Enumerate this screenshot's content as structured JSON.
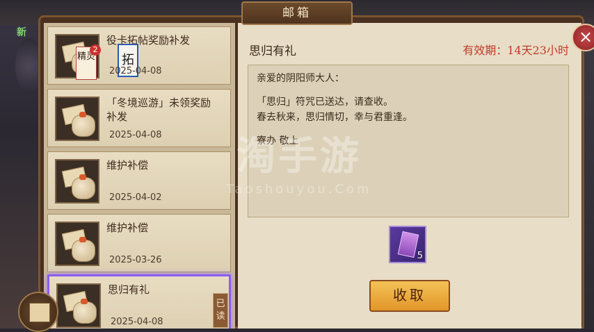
{
  "window": {
    "title": "邮箱"
  },
  "side": {
    "new_label": "新"
  },
  "mails": [
    {
      "title": "役卡拓帖奖励补发",
      "date": "2025-04-08",
      "badge": "2",
      "card_a": "精灵",
      "card_b": "拓"
    },
    {
      "title": "「冬境巡游」未领奖励补发",
      "date": "2025-04-08"
    },
    {
      "title": "维护补偿",
      "date": "2025-04-02"
    },
    {
      "title": "维护补偿",
      "date": "2025-03-26"
    },
    {
      "title": "思归有礼",
      "date": "2025-04-08",
      "read_tag": "已读",
      "selected": true
    }
  ],
  "detail": {
    "title": "思归有礼",
    "validity": "有效期：14天23小时",
    "body": [
      "亲爱的阴阳师大人：",
      "「思归」符咒已送达，请查收。",
      "春去秋来，思归情切，幸与君重逢。",
      "寮办 敬上"
    ],
    "reward": {
      "icon": "talisman-icon",
      "count": "5"
    },
    "claim_label": "收取"
  },
  "watermark": {
    "main": "淘手游",
    "sub": "Taoshouyou.Com"
  },
  "colors": {
    "accent_red": "#c03a2a",
    "selected_border": "#8a5cf0",
    "claim_button": "#f3c256"
  }
}
